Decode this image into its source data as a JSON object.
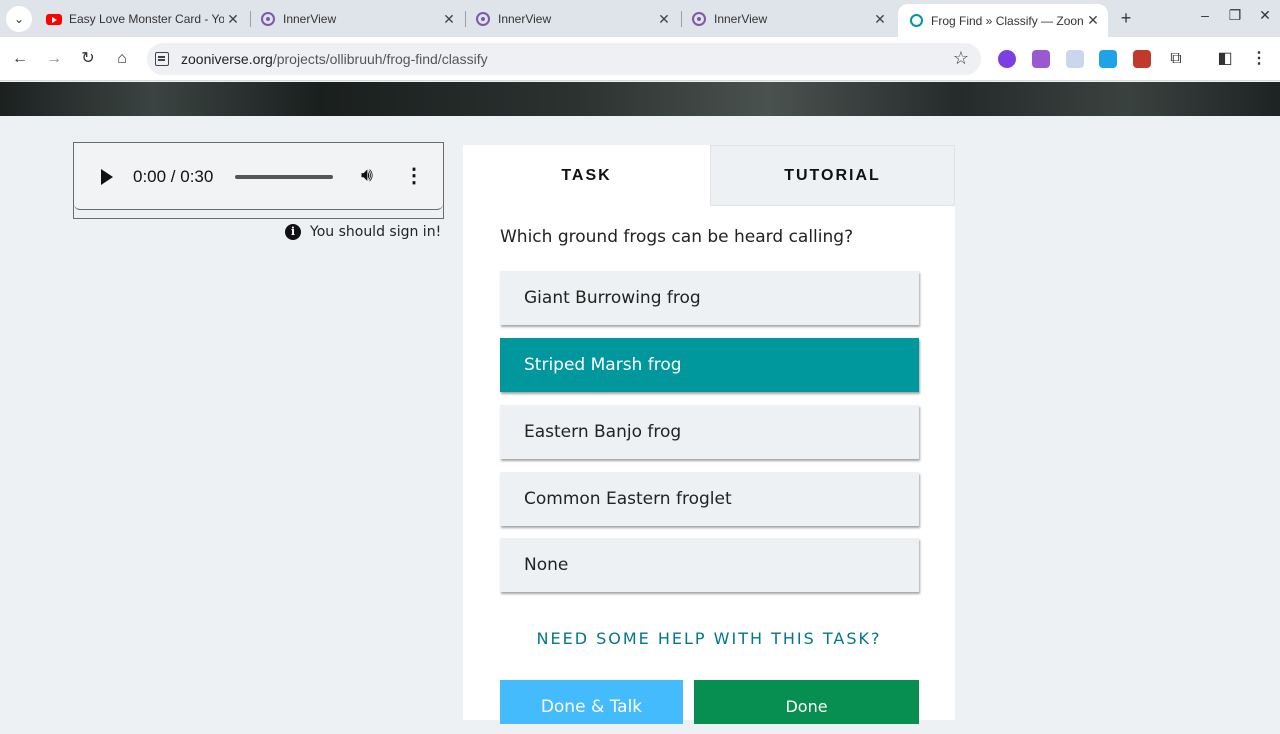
{
  "browser": {
    "tabs": [
      {
        "title": "Easy Love Monster Card - You",
        "icon": "youtube-icon"
      },
      {
        "title": "InnerView",
        "icon": "innerview-icon"
      },
      {
        "title": "InnerView",
        "icon": "innerview-icon"
      },
      {
        "title": "InnerView",
        "icon": "innerview-icon"
      },
      {
        "title": "Frog Find » Classify — Zooniv",
        "icon": "zooniverse-icon",
        "active": true
      }
    ],
    "url_domain": "zooniverse.org",
    "url_path": "/projects/ollibruuh/frog-find/classify"
  },
  "audio": {
    "time": "0:00 / 0:30"
  },
  "signin_text": "You should sign in!",
  "task": {
    "tab_task": "TASK",
    "tab_tutorial": "TUTORIAL",
    "question": "Which ground frogs can be heard calling?",
    "answers": [
      {
        "label": "Giant Burrowing frog",
        "selected": false
      },
      {
        "label": "Striped Marsh frog",
        "selected": true
      },
      {
        "label": "Eastern Banjo frog",
        "selected": false
      },
      {
        "label": "Common Eastern froglet",
        "selected": false
      },
      {
        "label": "None",
        "selected": false
      }
    ],
    "help": "NEED SOME HELP WITH THIS TASK?",
    "done_talk": "Done & Talk",
    "done": "Done"
  },
  "colors": {
    "selected_answer": "#00979d",
    "done_talk": "#43bbfd",
    "done": "#078f52",
    "help_link": "#00778c"
  }
}
